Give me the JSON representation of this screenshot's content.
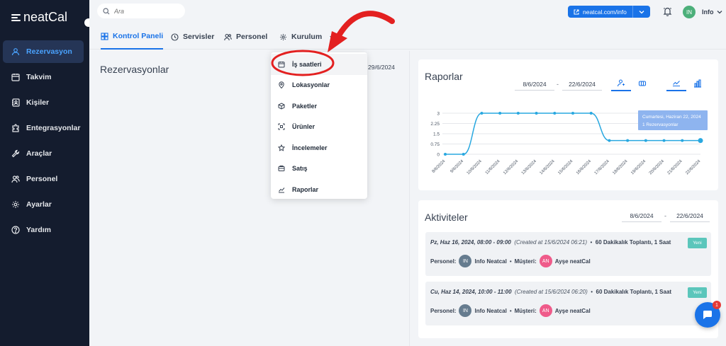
{
  "app": {
    "logo_text": "neatCal",
    "brand_color": "#1a73e8",
    "sidebar_bg": "#141c2e"
  },
  "sidebar": {
    "items": [
      {
        "label": "Rezervasyon",
        "icon": "user-icon",
        "active": true
      },
      {
        "label": "Takvim",
        "icon": "calendar-icon"
      },
      {
        "label": "Kişiler",
        "icon": "contacts-icon"
      },
      {
        "label": "Entegrasyonlar",
        "icon": "puzzle-icon"
      },
      {
        "label": "Araçlar",
        "icon": "wrench-icon"
      },
      {
        "label": "Personel",
        "icon": "users-icon"
      },
      {
        "label": "Ayarlar",
        "icon": "gear-icon"
      },
      {
        "label": "Yardım",
        "icon": "help-icon"
      }
    ]
  },
  "topbar": {
    "search_placeholder": "Ara",
    "url_label": "neatcal.com/info",
    "avatar_initials": "IN",
    "user_name": "Info"
  },
  "tabs": [
    {
      "label": "Kontrol Paneli",
      "active": true
    },
    {
      "label": "Servisler"
    },
    {
      "label": "Personel"
    },
    {
      "label": "Kurulum"
    }
  ],
  "dropdown": {
    "items": [
      {
        "label": "İş saatleri",
        "icon": "calendar-icon",
        "highlighted": true
      },
      {
        "label": "Lokasyonlar",
        "icon": "location-icon"
      },
      {
        "label": "Paketler",
        "icon": "package-icon"
      },
      {
        "label": "Ürünler",
        "icon": "product-icon"
      },
      {
        "label": "İncelemeler",
        "icon": "star-icon"
      },
      {
        "label": "Satış",
        "icon": "sales-icon"
      },
      {
        "label": "Raporlar",
        "icon": "chart-icon"
      }
    ]
  },
  "reservations": {
    "title": "Rezervasyonlar",
    "date": "29/6/2024"
  },
  "reports": {
    "title": "Raporlar",
    "date_from": "8/6/2024",
    "date_to": "22/6/2024",
    "dash": "-",
    "tooltip_line1": "Cumartesi, Haziran 22, 2024",
    "tooltip_line2": "1 Rezervasyonlar"
  },
  "chart_data": {
    "type": "line",
    "x": [
      "8/6/2024",
      "9/6/2024",
      "10/6/2024",
      "11/6/2024",
      "12/6/2024",
      "13/6/2024",
      "14/6/2024",
      "15/6/2024",
      "16/6/2024",
      "17/6/2024",
      "18/6/2024",
      "19/6/2024",
      "20/6/2024",
      "21/6/2024",
      "22/6/2024"
    ],
    "values": [
      0,
      0,
      3,
      3,
      3,
      3,
      3,
      3,
      3,
      1,
      1,
      1,
      1,
      1,
      1
    ],
    "yticks": [
      "3",
      "2.25",
      "1.5",
      "0.75",
      "0"
    ],
    "ylim": [
      0,
      3
    ],
    "color": "#29a8e0",
    "grid": true
  },
  "activities": {
    "title": "Aktiviteler",
    "date_from": "8/6/2024",
    "date_to": "22/6/2024",
    "items": [
      {
        "datetime": "Pz, Haz 16, 2024, 08:00 - 09:00",
        "created": "(Created at 15/6/2024 06:21)",
        "sep": "•",
        "service": "60 Dakikalık Toplantı, 1 Saat",
        "badge": "Yeni",
        "staff_label": "Personel:",
        "staff_initials": "IN",
        "staff_name": "Info Neatcal",
        "customer_label": "Müşteri:",
        "customer_initials": "AN",
        "customer_name": "Ayşe neatCal"
      },
      {
        "datetime": "Cu, Haz 14, 2024, 10:00 - 11:00",
        "created": "(Created at 15/6/2024 06:20)",
        "sep": "•",
        "service": "60 Dakikalık Toplantı, 1 Saat",
        "badge": "Yeni",
        "staff_label": "Personel:",
        "staff_initials": "IN",
        "staff_name": "Info Neatcal",
        "customer_label": "Müşteri:",
        "customer_initials": "AN",
        "customer_name": "Ayşe neatCal"
      }
    ]
  },
  "chat": {
    "unread_count": "1"
  }
}
